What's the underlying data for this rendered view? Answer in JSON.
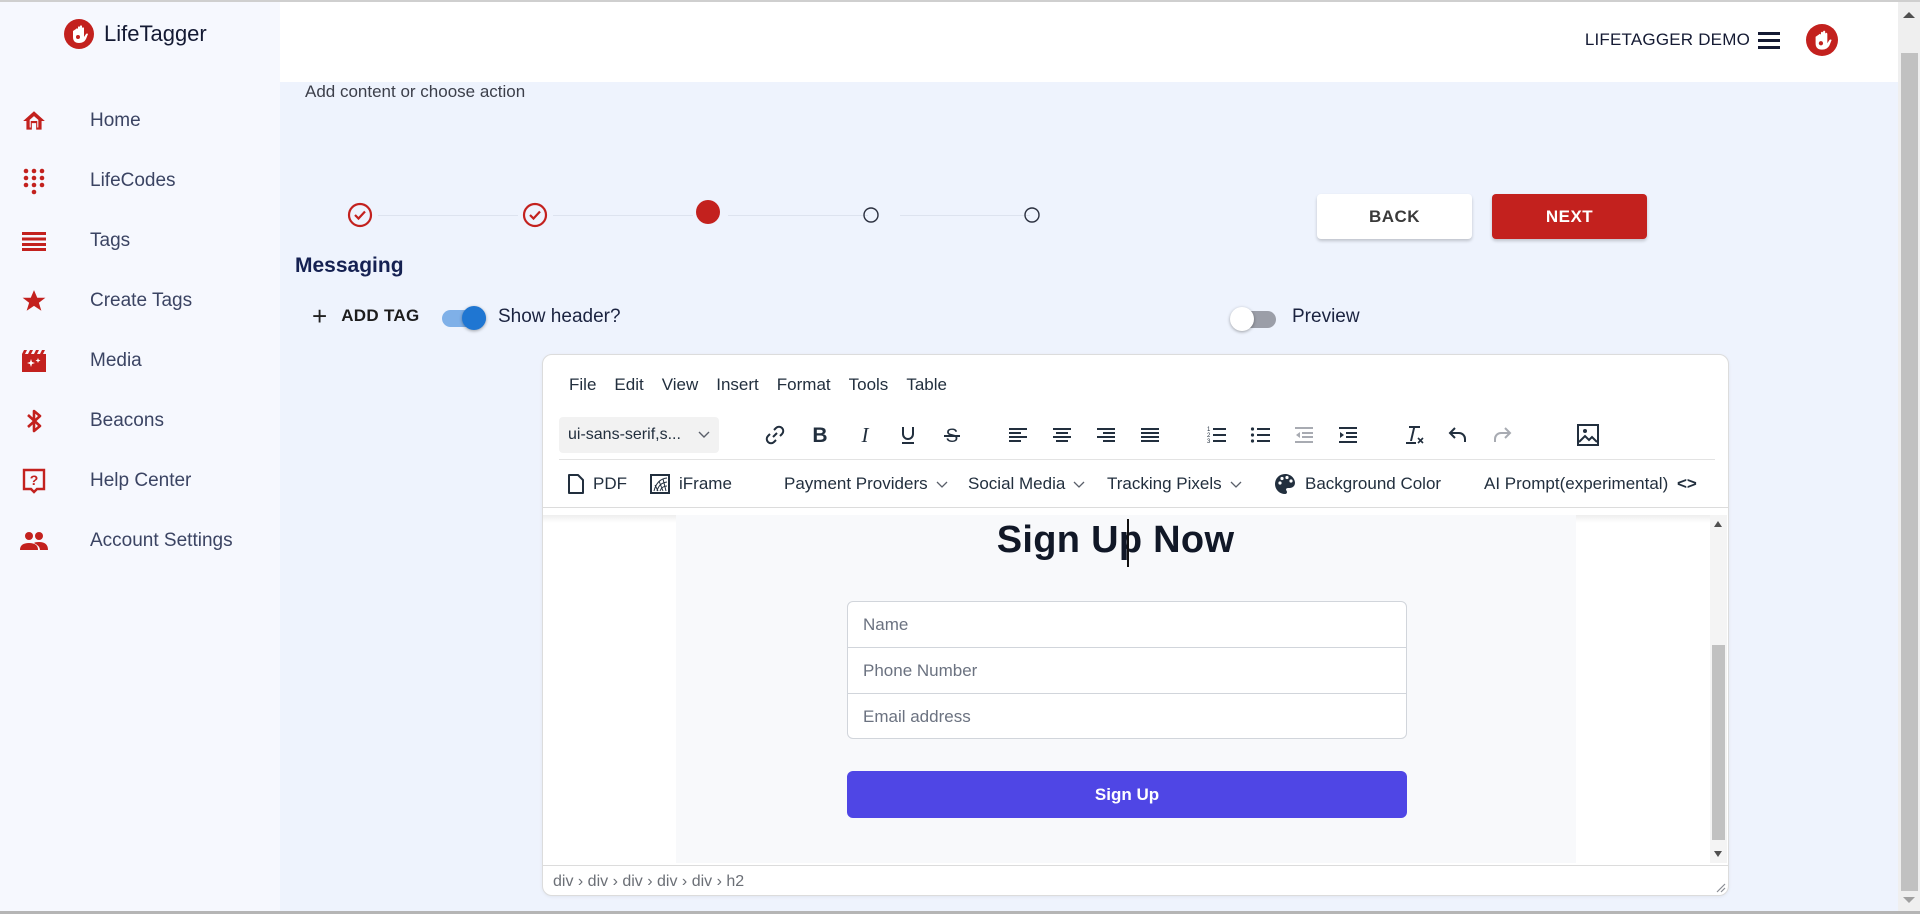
{
  "app": {
    "name": "LifeTagger",
    "brand_color": "#c3211e"
  },
  "header": {
    "account_name": "LIFETAGGER DEMO"
  },
  "sidebar": {
    "items": [
      {
        "label": "Home",
        "icon": "home-icon"
      },
      {
        "label": "LifeCodes",
        "icon": "dialpad-icon"
      },
      {
        "label": "Tags",
        "icon": "list-icon"
      },
      {
        "label": "Create Tags",
        "icon": "star-icon"
      },
      {
        "label": "Media",
        "icon": "movie-icon"
      },
      {
        "label": "Beacons",
        "icon": "bluetooth-icon"
      },
      {
        "label": "Help Center",
        "icon": "help-icon"
      },
      {
        "label": "Account Settings",
        "icon": "people-icon"
      }
    ]
  },
  "main": {
    "subtitle": "Add content or choose action",
    "stepper": {
      "steps": [
        {
          "state": "completed"
        },
        {
          "state": "completed"
        },
        {
          "state": "active"
        },
        {
          "state": "pending"
        },
        {
          "state": "pending"
        }
      ],
      "current_step": 3,
      "total_steps": 5
    },
    "back_label": "BACK",
    "next_label": "NEXT",
    "section_title": "Messaging",
    "add_tag_label": "ADD TAG",
    "show_header": {
      "label": "Show header?",
      "checked": true
    },
    "preview": {
      "label": "Preview",
      "checked": false
    }
  },
  "editor": {
    "menu": [
      "File",
      "Edit",
      "View",
      "Insert",
      "Format",
      "Tools",
      "Table"
    ],
    "font_family": "ui-sans-serif,s...",
    "toolbar1": [
      "link",
      "bold",
      "italic",
      "underline",
      "strikethrough",
      "align-left",
      "align-center",
      "align-right",
      "justify",
      "numbered-list",
      "bullet-list",
      "outdent",
      "indent",
      "clear-formatting",
      "undo",
      "redo",
      "image"
    ],
    "toolbar2": {
      "pdf": "PDF",
      "iframe": "iFrame",
      "payment_providers": "Payment Providers",
      "social_media": "Social Media",
      "tracking_pixels": "Tracking Pixels",
      "background_color": "Background Color",
      "ai_prompt": "AI Prompt(experimental)",
      "source_code": "<>"
    },
    "content": {
      "title": "Sign Up Now",
      "fields": [
        {
          "placeholder": "Name"
        },
        {
          "placeholder": "Phone Number"
        },
        {
          "placeholder": "Email address"
        }
      ],
      "submit_label": "Sign Up",
      "submit_color": "#4f46e5"
    },
    "status_path": "div › div › div › div › div › h2"
  }
}
